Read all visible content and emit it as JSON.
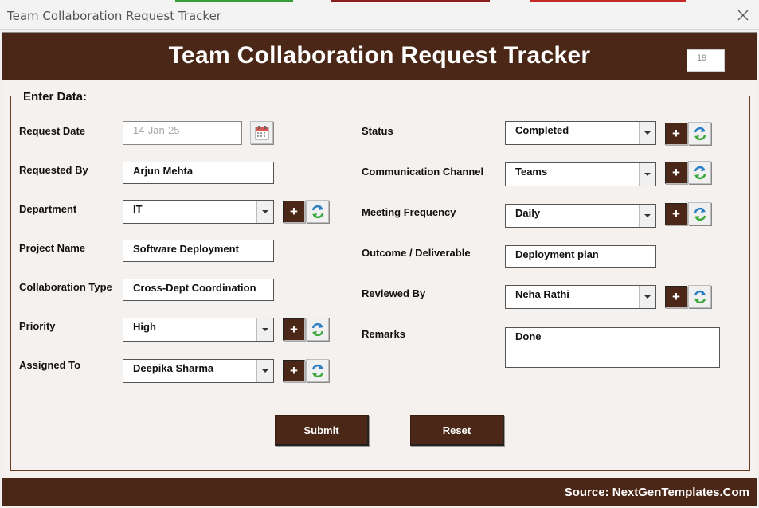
{
  "window": {
    "title": "Team Collaboration Request Tracker"
  },
  "header": {
    "title": "Team Collaboration Request Tracker",
    "record_id": "19"
  },
  "form": {
    "group_label": "Enter Data:",
    "left": {
      "request_date": {
        "label": "Request Date",
        "value": "14-Jan-25"
      },
      "requested_by": {
        "label": "Requested By",
        "value": "Arjun Mehta"
      },
      "department": {
        "label": "Department",
        "value": "IT"
      },
      "project_name": {
        "label": "Project Name",
        "value": "Software Deployment"
      },
      "collaboration_type": {
        "label": "Collaboration Type",
        "value": "Cross-Dept Coordination"
      },
      "priority": {
        "label": "Priority",
        "value": "High"
      },
      "assigned_to": {
        "label": "Assigned To",
        "value": "Deepika Sharma"
      }
    },
    "right": {
      "status": {
        "label": "Status",
        "value": "Completed"
      },
      "communication_channel": {
        "label": "Communication Channel",
        "value": "Teams"
      },
      "meeting_frequency": {
        "label": "Meeting Frequency",
        "value": "Daily"
      },
      "outcome": {
        "label": "Outcome / Deliverable",
        "value": "Deployment plan"
      },
      "reviewed_by": {
        "label": "Reviewed By",
        "value": "Neha Rathi"
      },
      "remarks": {
        "label": "Remarks",
        "value": "Done"
      }
    },
    "add_symbol": "+",
    "submit_label": "Submit",
    "reset_label": "Reset"
  },
  "footer": {
    "source": "Source: NextGenTemplates.Com"
  },
  "colors": {
    "brand": "#4a2717",
    "background": "#f4f1ee"
  },
  "icons": {
    "calendar": "calendar-icon",
    "refresh": "refresh-icon",
    "close": "close-icon",
    "dropdown": "chevron-down-icon"
  }
}
